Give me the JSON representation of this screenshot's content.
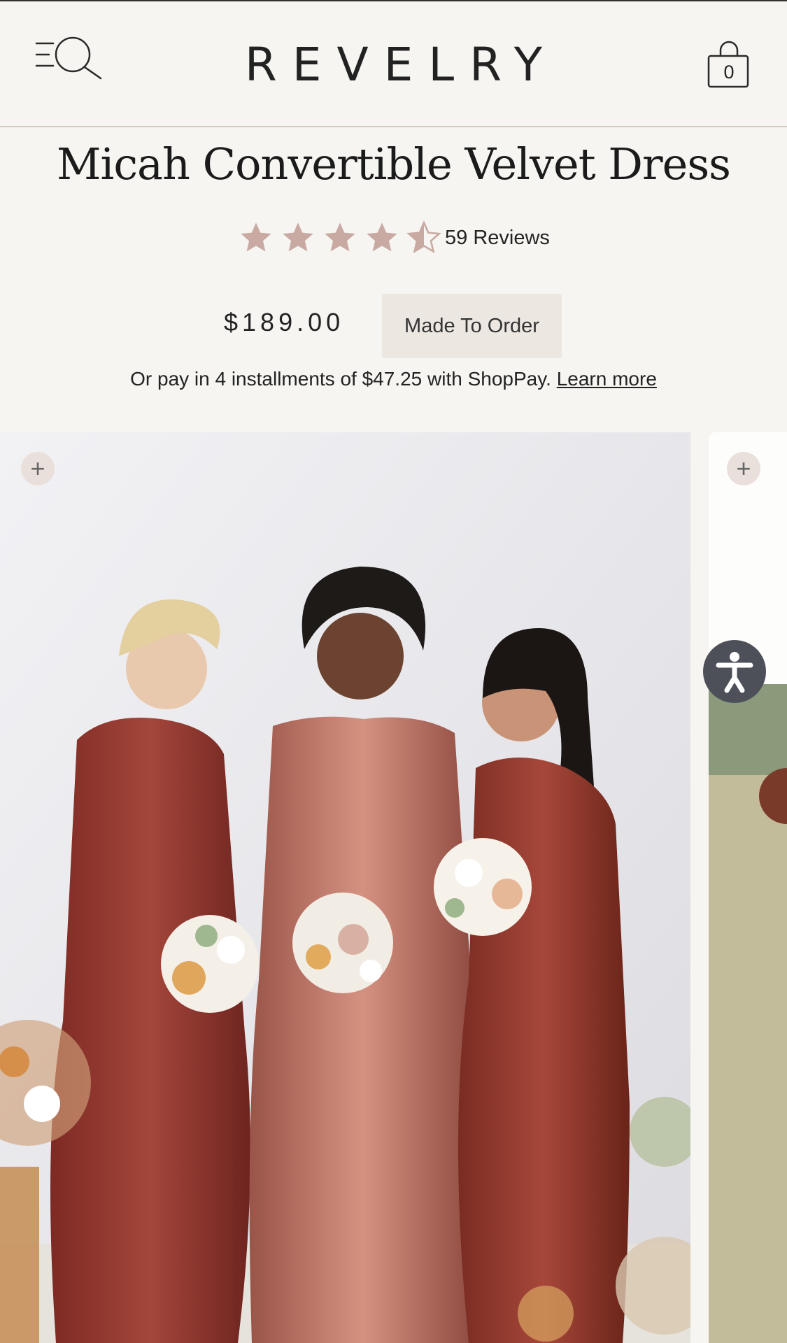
{
  "header": {
    "logo": "REVELRY",
    "cart_count": "0"
  },
  "product": {
    "title": "Micah Convertible Velvet Dress",
    "rating": 4.5,
    "rating_max": 5,
    "reviews": "59 Reviews",
    "price": "$189.00",
    "badge": "Made To Order",
    "installments_text": "Or pay in 4 installments of $47.25 with ShopPay.",
    "learn_more": "Learn more"
  },
  "gallery": {
    "plus_icon": "+"
  },
  "colors": {
    "star": "#c9aaa3",
    "velvet": "#9c4034"
  }
}
